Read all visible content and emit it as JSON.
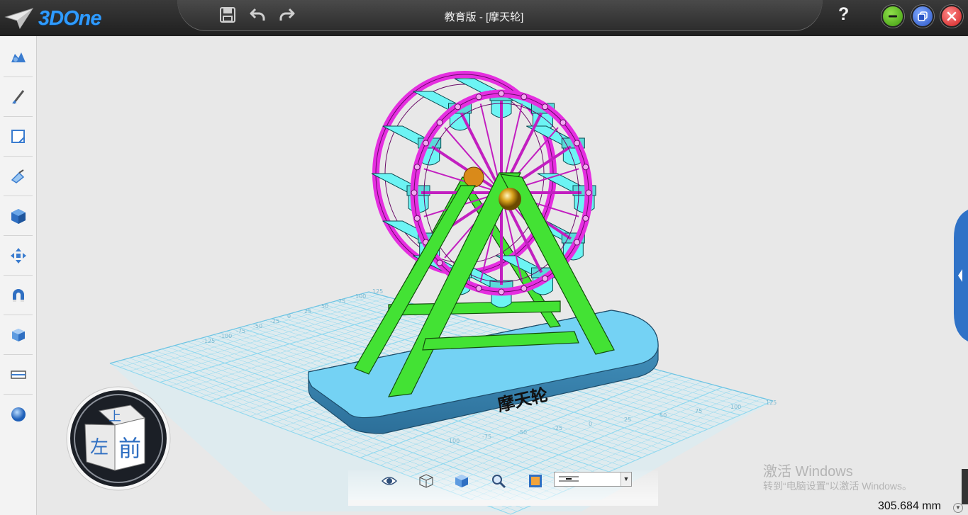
{
  "app": {
    "logo_text": "3DOne",
    "title": "教育版 - [摩天轮]",
    "help_label": "?"
  },
  "titlebar_tools": [
    "save-icon",
    "undo-icon",
    "redo-icon"
  ],
  "window_buttons": [
    {
      "name": "minimize-button",
      "icon": "minus-icon",
      "color": "#4caf14"
    },
    {
      "name": "restore-button",
      "icon": "restore-icon",
      "color": "#3a6fd8"
    },
    {
      "name": "close-button",
      "icon": "close-icon",
      "color": "#e03232"
    }
  ],
  "left_toolbar": [
    "basic-solid-icon",
    "sketch-icon",
    "sketch-edit-icon",
    "feature-icon",
    "combine-icon",
    "transform-icon",
    "magnet-icon",
    "assembly-icon",
    "measure-icon",
    "material-icon"
  ],
  "model": {
    "label": "摩天轮",
    "colors": {
      "wheel": "#e52ee0",
      "frame": "#3ee22f",
      "cabin": "#6cf4f4",
      "base": "#74d2f4",
      "grid": "#8fd8ef"
    }
  },
  "grid_labels": {
    "x_axis": [
      "125",
      "100",
      "75",
      "50",
      "25",
      "0",
      "-25",
      "-50",
      "-75",
      "-100"
    ],
    "y_axis": [
      "-125",
      "-100",
      "-75",
      "-50",
      "-25",
      "0",
      "25",
      "50",
      "75",
      "100",
      "125"
    ]
  },
  "view_cube": {
    "front": "前",
    "left": "左",
    "top": "上"
  },
  "bottom_toolbar": [
    "view-eye-icon",
    "wireframe-icon",
    "shaded-icon",
    "zoom-icon",
    "render-icon"
  ],
  "view_select": {
    "value": ""
  },
  "status": {
    "measurement": "305.684 mm"
  },
  "watermark": {
    "line1": "激活 Windows",
    "line2": "转到“电脑设置”以激活 Windows。"
  }
}
